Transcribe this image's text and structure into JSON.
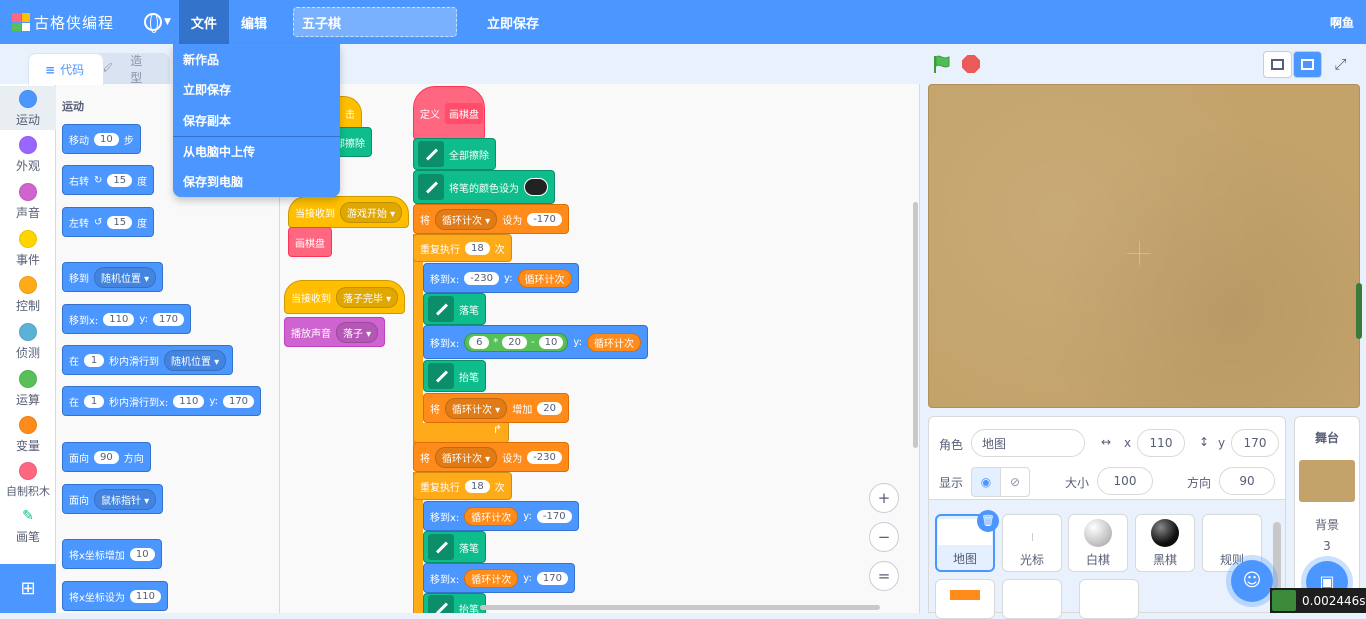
{
  "menubar": {
    "logo_text": "古格侠编程",
    "file": "文件",
    "edit": "编辑",
    "project_title": "五子棋",
    "save_now": "立即保存",
    "user": "啊鱼"
  },
  "file_menu": [
    "新作品",
    "立即保存",
    "保存副本",
    "从电脑中上传",
    "保存到电脑"
  ],
  "tabs": {
    "code": "代码",
    "costume": "造型"
  },
  "categories": [
    {
      "label": "运动",
      "color": "#4c97ff"
    },
    {
      "label": "外观",
      "color": "#9966ff"
    },
    {
      "label": "声音",
      "color": "#cf63cf"
    },
    {
      "label": "事件",
      "color": "#ffd500"
    },
    {
      "label": "控制",
      "color": "#ffab19"
    },
    {
      "label": "侦测",
      "color": "#5cb1d6"
    },
    {
      "label": "运算",
      "color": "#59c059"
    },
    {
      "label": "变量",
      "color": "#ff8c1a"
    },
    {
      "label": "自制积木",
      "color": "#ff6680"
    },
    {
      "label": "画笔",
      "color": "#0fbd8c"
    }
  ],
  "palette": {
    "heading": "运动",
    "move": {
      "a": "移动",
      "n": "10",
      "b": "步"
    },
    "turn_right": {
      "a": "右转",
      "n": "15",
      "b": "度"
    },
    "turn_left": {
      "a": "左转",
      "n": "15",
      "b": "度"
    },
    "goto": {
      "a": "移到",
      "dd": "随机位置"
    },
    "gotoxy": {
      "a": "移到x:",
      "x": "110",
      "yl": "y:",
      "y": "170"
    },
    "glide": {
      "a": "在",
      "n": "1",
      "b": "秒内滑行到",
      "dd": "随机位置"
    },
    "glidexy": {
      "a": "在",
      "n": "1",
      "b": "秒内滑行到x:",
      "x": "110",
      "yl": "y:",
      "y": "170"
    },
    "point": {
      "a": "面向",
      "n": "90",
      "b": "方向"
    },
    "pointto": {
      "a": "面向",
      "dd": "鼠标指针"
    },
    "changex": {
      "a": "将x坐标增加",
      "n": "10"
    },
    "setx": {
      "a": "将x坐标设为",
      "n": "110"
    }
  },
  "script_left": {
    "hat_click": "击",
    "erase": "部擦除",
    "recv1": "当接收到",
    "recv1_dd": "游戏开始",
    "call": "画棋盘",
    "recv2": "当接收到",
    "recv2_dd": "落子完毕",
    "play": "播放声音",
    "play_dd": "落子"
  },
  "script_main": {
    "define": "定义",
    "define_name": "画棋盘",
    "erase_all": "全部擦除",
    "set_pen_color": "将笔的颜色设为",
    "set1": {
      "a": "将",
      "dd": "循环计次",
      "b": "设为",
      "v": "-170"
    },
    "repeat1": {
      "a": "重复执行",
      "n": "18",
      "b": "次"
    },
    "goto1": {
      "a": "移到x:",
      "x": "-230",
      "yl": "y:",
      "ydd": "循环计次"
    },
    "pen_down1": "落笔",
    "goto2": {
      "a": "移到x:",
      "n1": "6",
      "op1": "*",
      "n2": "20",
      "op2": "-",
      "n3": "10",
      "yl": "y:",
      "ydd": "循环计次"
    },
    "pen_up1": "抬笔",
    "change1": {
      "a": "将",
      "dd": "循环计次",
      "b": "增加",
      "v": "20"
    },
    "set2": {
      "a": "将",
      "dd": "循环计次",
      "b": "设为",
      "v": "-230"
    },
    "repeat2": {
      "a": "重复执行",
      "n": "18",
      "b": "次"
    },
    "goto3": {
      "a": "移到x:",
      "xdd": "循环计次",
      "yl": "y:",
      "y": "-170"
    },
    "pen_down2": "落笔",
    "goto4": {
      "a": "移到x:",
      "xdd": "循环计次",
      "yl": "y:",
      "y": "170"
    },
    "pen_up2": "抬笔"
  },
  "zoom": {
    "in": "+",
    "out": "−",
    "reset": "="
  },
  "sprite_info": {
    "sprite_label": "角色",
    "sprite_name": "地图",
    "x_label": "x",
    "x": "110",
    "y_label": "y",
    "y": "170",
    "show_label": "显示",
    "size_label": "大小",
    "size": "100",
    "dir_label": "方向",
    "dir": "90"
  },
  "sprites": [
    {
      "name": "地图"
    },
    {
      "name": "光标"
    },
    {
      "name": "白棋"
    },
    {
      "name": "黑棋"
    },
    {
      "name": "规则"
    }
  ],
  "stage_panel": {
    "title": "舞台",
    "backdrop_label": "背景",
    "backdrop_count": "3"
  },
  "fps": "0.002446s"
}
